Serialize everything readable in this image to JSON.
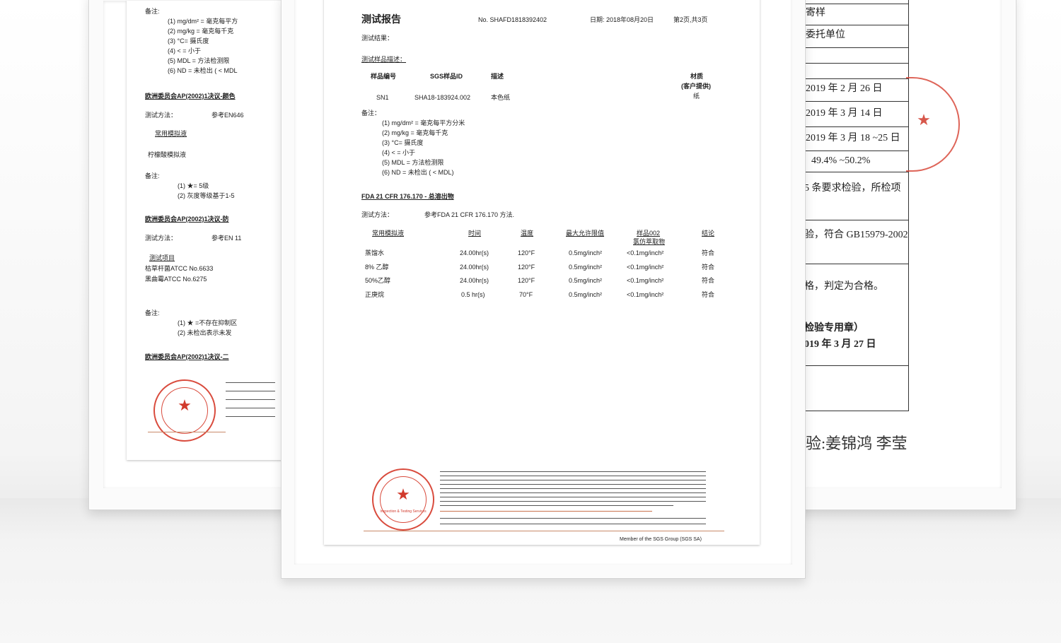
{
  "left_doc": {
    "notes_label": "备注:",
    "notes": [
      "(1) mg/dm² = 毫克每平方",
      "(2) mg/kg = 毫克每千克",
      "(3) °C= 摄氏度",
      "(4) < = 小于",
      "(5) MDL = 方法检测限",
      "(6) ND = 未检出 ( < MDL"
    ],
    "section1": "欧洲委员会AP(2002)1决议-颜色",
    "method_label": "测试方法：",
    "method1": "参考EN646",
    "sub1": "常用模拟液",
    "sub1_item": "柠檬酸模拟液",
    "notes2_label": "备注:",
    "notes2": [
      "(1) ★= 5级",
      "(2) 灰度等级基于1-5"
    ],
    "section2": "欧洲委员会AP(2002)1决议-防",
    "method2_label": "测试方法：",
    "method2": "参考EN 11",
    "sub2": "测试项目",
    "sub2_items": [
      "枯草杆菌ATCC No.6633",
      "黑曲霉ATCC No.6275"
    ],
    "notes3_label": "备注:",
    "notes3": [
      "(1) ★ =不存在抑制区",
      "(2) 未检出表示未发"
    ],
    "section3": "欧洲委员会AP(2002)1决议-二"
  },
  "center_doc": {
    "title": "测试报告",
    "report_no": "No. SHAFD1818392402",
    "date": "日期: 2018年08月20日",
    "page": "第2页,共3页",
    "result_label": "测试结果：",
    "sample_desc_label": "测试样品描述：",
    "sample_table": {
      "headers": [
        "样品编号",
        "SGS样品ID",
        "描述",
        "材质",
        "(客户提供)"
      ],
      "row": [
        "SN1",
        "SHA18-183924.002",
        "本色纸",
        "纸"
      ]
    },
    "notes_label": "备注：",
    "notes": [
      "(1) mg/dm² = 毫克每平方分米",
      "(2) mg/kg = 毫克每千克",
      "(3) °C= 摄氏度",
      "(4) < = 小于",
      "(5) MDL = 方法检测限",
      "(6) ND = 未检出 ( < MDL)"
    ],
    "fda_title": "FDA 21 CFR 176.170 - 总溶出物",
    "fda_method_label": "测试方法：",
    "fda_method": "参考FDA 21 CFR 176.170 方法.",
    "results": {
      "headers": [
        "常用模拟液",
        "时间",
        "温度",
        "最大允许限值",
        "样品002",
        "结论"
      ],
      "header_sub": "氯仿萃取物",
      "rows": [
        [
          "蒸馏水",
          "24.00hr(s)",
          "120°F",
          "0.5mg/inch²",
          "<0.1mg/inch²",
          "符合"
        ],
        [
          "8% 乙醇",
          "24.00hr(s)",
          "120°F",
          "0.5mg/inch²",
          "<0.1mg/inch²",
          "符合"
        ],
        [
          "50%乙醇",
          "24.00hr(s)",
          "120°F",
          "0.5mg/inch²",
          "<0.1mg/inch²",
          "符合"
        ],
        [
          "正庚烷",
          "0.5 hr(s)",
          "70°F",
          "0.5mg/inch²",
          "<0.1mg/inch²",
          "符合"
        ]
      ]
    },
    "seal_caption": "Inspection & Testing Services",
    "footer_member": "Member of the SGS Group (SGS SA)"
  },
  "right_doc": {
    "rows": [
      "寄样",
      "委托单位",
      "",
      "",
      "2019 年 2 月 26 日",
      "2019 年 3 月 14 日",
      "2019 年 3 月 18 ~25 日",
      "49.4% ~50.2%",
      "5 条要求检验，所检项",
      "验，符合 GB15979-2002",
      "格，判定为合格。",
      "检验专用章）",
      "019 年 3 月 27 日"
    ],
    "signature": "验:姜锦鸿 李莹"
  },
  "colors": {
    "seal": "#d94b3d",
    "background": "#f4f4f4",
    "frame": "#fbfbfb"
  }
}
